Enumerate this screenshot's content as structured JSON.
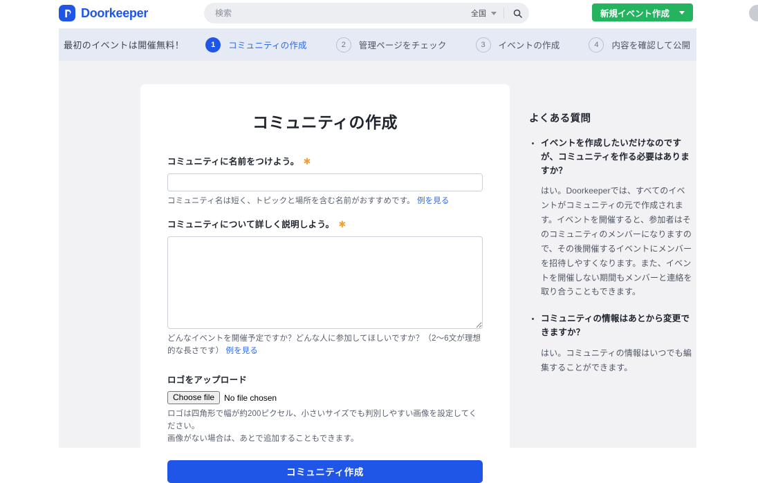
{
  "nav": {
    "brand": "Doorkeeper",
    "brand_icon": "doorkeeper-logo-icon",
    "brand_color": "#1f56e8",
    "search_placeholder": "検索",
    "search_value": "",
    "search_icon": "search-icon",
    "region_label": "全国",
    "region_caret_icon": "chevron-down-icon",
    "new_event_label": "新規イベント作成",
    "new_event_caret_icon": "chevron-down-icon",
    "new_event_color": "#24b35f",
    "avatar_icon": "user-avatar"
  },
  "stepper": {
    "promo": "最初のイベントは開催無料！",
    "active_color": "#1f56e8",
    "bar_color": "#e6eaf4",
    "steps": [
      {
        "num": "1",
        "label": "コミュニティの作成",
        "state": "active"
      },
      {
        "num": "2",
        "label": "管理ページをチェック",
        "state": "idle"
      },
      {
        "num": "3",
        "label": "イベントの作成",
        "state": "idle"
      },
      {
        "num": "4",
        "label": "内容を確認して公開",
        "state": "idle"
      }
    ]
  },
  "form": {
    "title": "コミュニティの作成",
    "required_marker": "✱",
    "name_field": {
      "label": "コミュニティに名前をつけよう。",
      "value": "",
      "placeholder": "",
      "hint": "コミュニティ名は短く、トピックと場所を含む名前がおすすめです。",
      "hint_link": "例を見る"
    },
    "description_field": {
      "label": "コミュニティについて詳しく説明しよう。",
      "value": "",
      "placeholder": "",
      "hint": "どんなイベントを開催予定ですか？どんな人に参加してほしいですか？（2〜6文が理想的な長さです）",
      "hint_link": "例を見る"
    },
    "logo_field": {
      "label": "ロゴをアップロード",
      "choose_file_label": "Choose file",
      "file_status": "No file chosen",
      "hint_line1": "ロゴは四角形で幅が約200ピクセル、小さいサイズでも判別しやすい画像を設定してください。",
      "hint_line2": "画像がない場合は、あとで追加することもできます。"
    },
    "submit_label": "コミュニティ作成",
    "submit_color": "#1f56e8"
  },
  "faq": {
    "title": "よくある質問",
    "items": [
      {
        "question": "イベントを作成したいだけなのですが、コミュニティを作る必要はありますか？",
        "answer": "はい。Doorkeeperでは、すべてのイベントがコミュニティの元で作成されます。イベントを開催すると、参加者はそのコミュニティのメンバーになりますので、その後開催するイベントにメンバーを招待しやすくなります。また、イベントを開催しない期間もメンバーと連絡を取り合うこともできます。"
      },
      {
        "question": "コミュニティの情報はあとから変更できますか？",
        "answer": "はい。コミュニティの情報はいつでも編集することができます。"
      }
    ]
  }
}
